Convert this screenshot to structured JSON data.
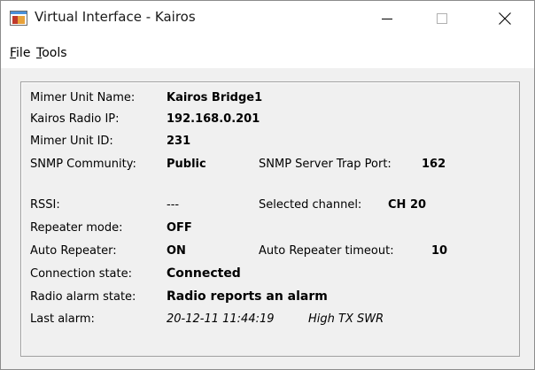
{
  "window": {
    "title": "Virtual Interface - Kairos",
    "icon": "app-window-icon"
  },
  "menu": {
    "file_rest": "ile",
    "file_mnemonic": "F",
    "tools_mnemonic": "T",
    "tools_rest": "ools"
  },
  "info": {
    "unit_name_label": "Mimer Unit Name:",
    "unit_name_value": "Kairos Bridge1",
    "radio_ip_label": "Kairos Radio IP:",
    "radio_ip_value": "192.168.0.201",
    "unit_id_label": "Mimer Unit ID:",
    "unit_id_value": "231",
    "snmp_community_label": "SNMP Community:",
    "snmp_community_value": "Public",
    "snmp_trap_port_label": "SNMP Server Trap Port:",
    "snmp_trap_port_value": "162",
    "rssi_label": "RSSI:",
    "rssi_value": "---",
    "selected_channel_label": "Selected channel:",
    "selected_channel_value": "CH 20",
    "repeater_mode_label": "Repeater mode:",
    "repeater_mode_value": "OFF",
    "auto_repeater_label": "Auto Repeater:",
    "auto_repeater_value": "ON",
    "auto_repeater_timeout_label": "Auto Repeater timeout:",
    "auto_repeater_timeout_value": "10",
    "connection_state_label": "Connection state:",
    "connection_state_value": "Connected",
    "radio_alarm_label": "Radio alarm state:",
    "radio_alarm_value": "Radio reports an alarm",
    "last_alarm_label": "Last alarm:",
    "last_alarm_time": "20-12-11 11:44:19",
    "last_alarm_desc": "High TX SWR"
  }
}
